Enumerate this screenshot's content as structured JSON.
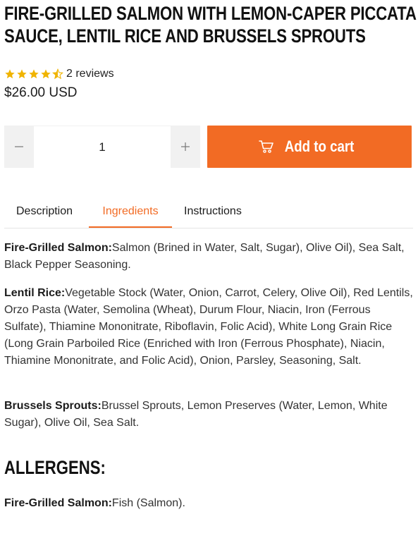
{
  "product": {
    "title": "FIRE-GRILLED SALMON WITH LEMON-CAPER PICCATA SAUCE, LENTIL RICE AND BRUSSELS SPROUTS",
    "rating_stars": 4.5,
    "reviews_text": "2 reviews",
    "price": "$26.00 USD"
  },
  "quantity": {
    "value": "1",
    "decrease_icon": "minus-icon",
    "increase_icon": "plus-icon"
  },
  "cart": {
    "label": "Add to cart",
    "icon": "cart-icon",
    "color": "#f26b24"
  },
  "tabs": [
    {
      "label": "Description"
    },
    {
      "label": "Ingredients"
    },
    {
      "label": "Instructions"
    }
  ],
  "active_tab": "Ingredients",
  "ingredients": [
    {
      "name": "Fire-Grilled Salmon:",
      "text": "Salmon (Brined in Water, Salt, Sugar), Olive Oil), Sea Salt, Black Pepper Seasoning."
    },
    {
      "name": "Lentil Rice:",
      "text": "Vegetable Stock (Water, Onion, Carrot, Celery, Olive Oil), Red Lentils, Orzo Pasta (Water, Semolina (Wheat), Durum Flour, Niacin, Iron (Ferrous Sulfate), Thiamine Mononitrate, Riboflavin, Folic Acid), White Long Grain Rice (Long Grain Parboiled Rice (Enriched with Iron (Ferrous Phosphate), Niacin, Thiamine Mononitrate, and Folic Acid), Onion, Parsley, Seasoning, Salt."
    },
    {
      "name": "Brussels Sprouts:",
      "text": "Brussel Sprouts, Lemon Preserves (Water, Lemon, White Sugar), Olive Oil, Sea Salt."
    }
  ],
  "allergens": {
    "title": "ALLERGENS:",
    "items": [
      {
        "name": "Fire-Grilled Salmon:",
        "text": "Fish (Salmon)."
      }
    ]
  },
  "colors": {
    "accent": "#f26b24",
    "star": "#f0b400"
  }
}
